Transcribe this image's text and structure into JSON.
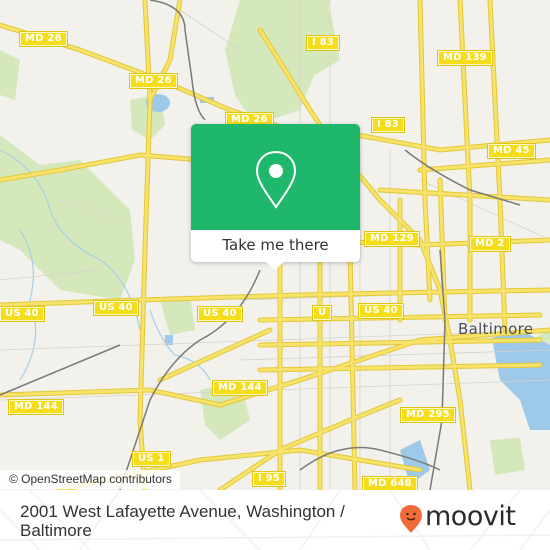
{
  "map": {
    "attribution": "© OpenStreetMap contributors",
    "city_label": "Baltimore",
    "road_shields": [
      {
        "id": "md26-a",
        "label": "MD 26"
      },
      {
        "id": "md26-b",
        "label": "MD 26"
      },
      {
        "id": "md26-c",
        "label": "MD 26"
      },
      {
        "id": "i83-a",
        "label": "I 83"
      },
      {
        "id": "i83-b",
        "label": "I 83"
      },
      {
        "id": "md139",
        "label": "MD 139"
      },
      {
        "id": "md45",
        "label": "MD 45"
      },
      {
        "id": "md129",
        "label": "MD 129"
      },
      {
        "id": "md2",
        "label": "MD 2"
      },
      {
        "id": "us40-a",
        "label": "US 40"
      },
      {
        "id": "us40-b",
        "label": "US 40"
      },
      {
        "id": "us40-c",
        "label": "US 40"
      },
      {
        "id": "us40-d",
        "label": "U"
      },
      {
        "id": "us40-e",
        "label": "US 40"
      },
      {
        "id": "md144-a",
        "label": "MD 144"
      },
      {
        "id": "md144-b",
        "label": "MD 144"
      },
      {
        "id": "md295",
        "label": "MD 295"
      },
      {
        "id": "us1",
        "label": "US 1"
      },
      {
        "id": "i95",
        "label": "I 95"
      },
      {
        "id": "md648",
        "label": "MD 648"
      }
    ],
    "colors": {
      "land": "#f2f1ec",
      "road": "#f5dd45",
      "park": "#d4e8bc",
      "water": "#9ecae9",
      "rail": "#7a7a7a"
    }
  },
  "popup": {
    "icon": "location-pin-icon",
    "button_label": "Take me there",
    "color": "#1fb76b"
  },
  "footer": {
    "address": "2001 West Lafayette Avenue, Washington / Baltimore",
    "brand": "moovit",
    "brand_color": "#f26b3a"
  }
}
